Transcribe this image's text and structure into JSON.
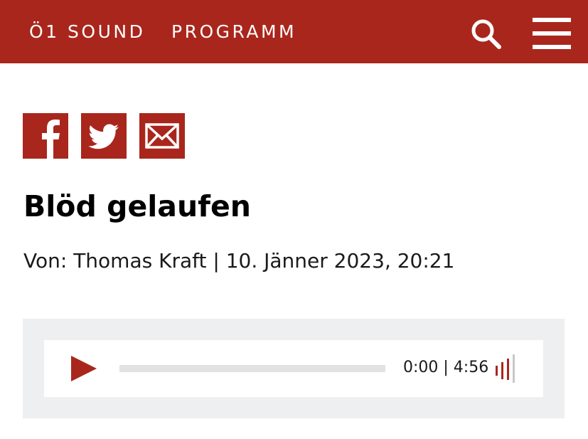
{
  "header": {
    "nav_sound": "Ö1 SOUND",
    "nav_programm": "PROGRAMM",
    "search_icon": "search-icon",
    "menu_icon": "hamburger-menu-icon"
  },
  "share": {
    "facebook_icon": "facebook-icon",
    "twitter_icon": "twitter-icon",
    "mail_icon": "mail-icon"
  },
  "article": {
    "title": "Blöd gelaufen",
    "meta": "Von: Thomas Kraft | 10. Jänner 2023, 20:21"
  },
  "player": {
    "play_icon": "play-icon",
    "volume_icon": "volume-icon",
    "time": "0:00 | 4:56",
    "progress": 0
  },
  "colors": {
    "brand": "#a9261c",
    "player_background": "#eeeff1",
    "progress_track": "#e2e2e2"
  }
}
